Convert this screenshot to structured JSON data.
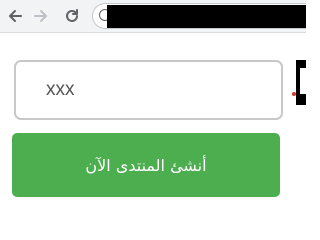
{
  "browser": {
    "back_icon": "back-arrow-icon",
    "forward_icon": "forward-arrow-icon",
    "reload_icon": "reload-icon",
    "info_icon": "info-icon"
  },
  "form": {
    "name_value": "xxx",
    "create_button_label": "أنشئ المنتدى الآن"
  },
  "colors": {
    "button_bg": "#4cae4f",
    "input_border": "#c8c8c8",
    "toolbar_bg": "#f1f3f4"
  }
}
